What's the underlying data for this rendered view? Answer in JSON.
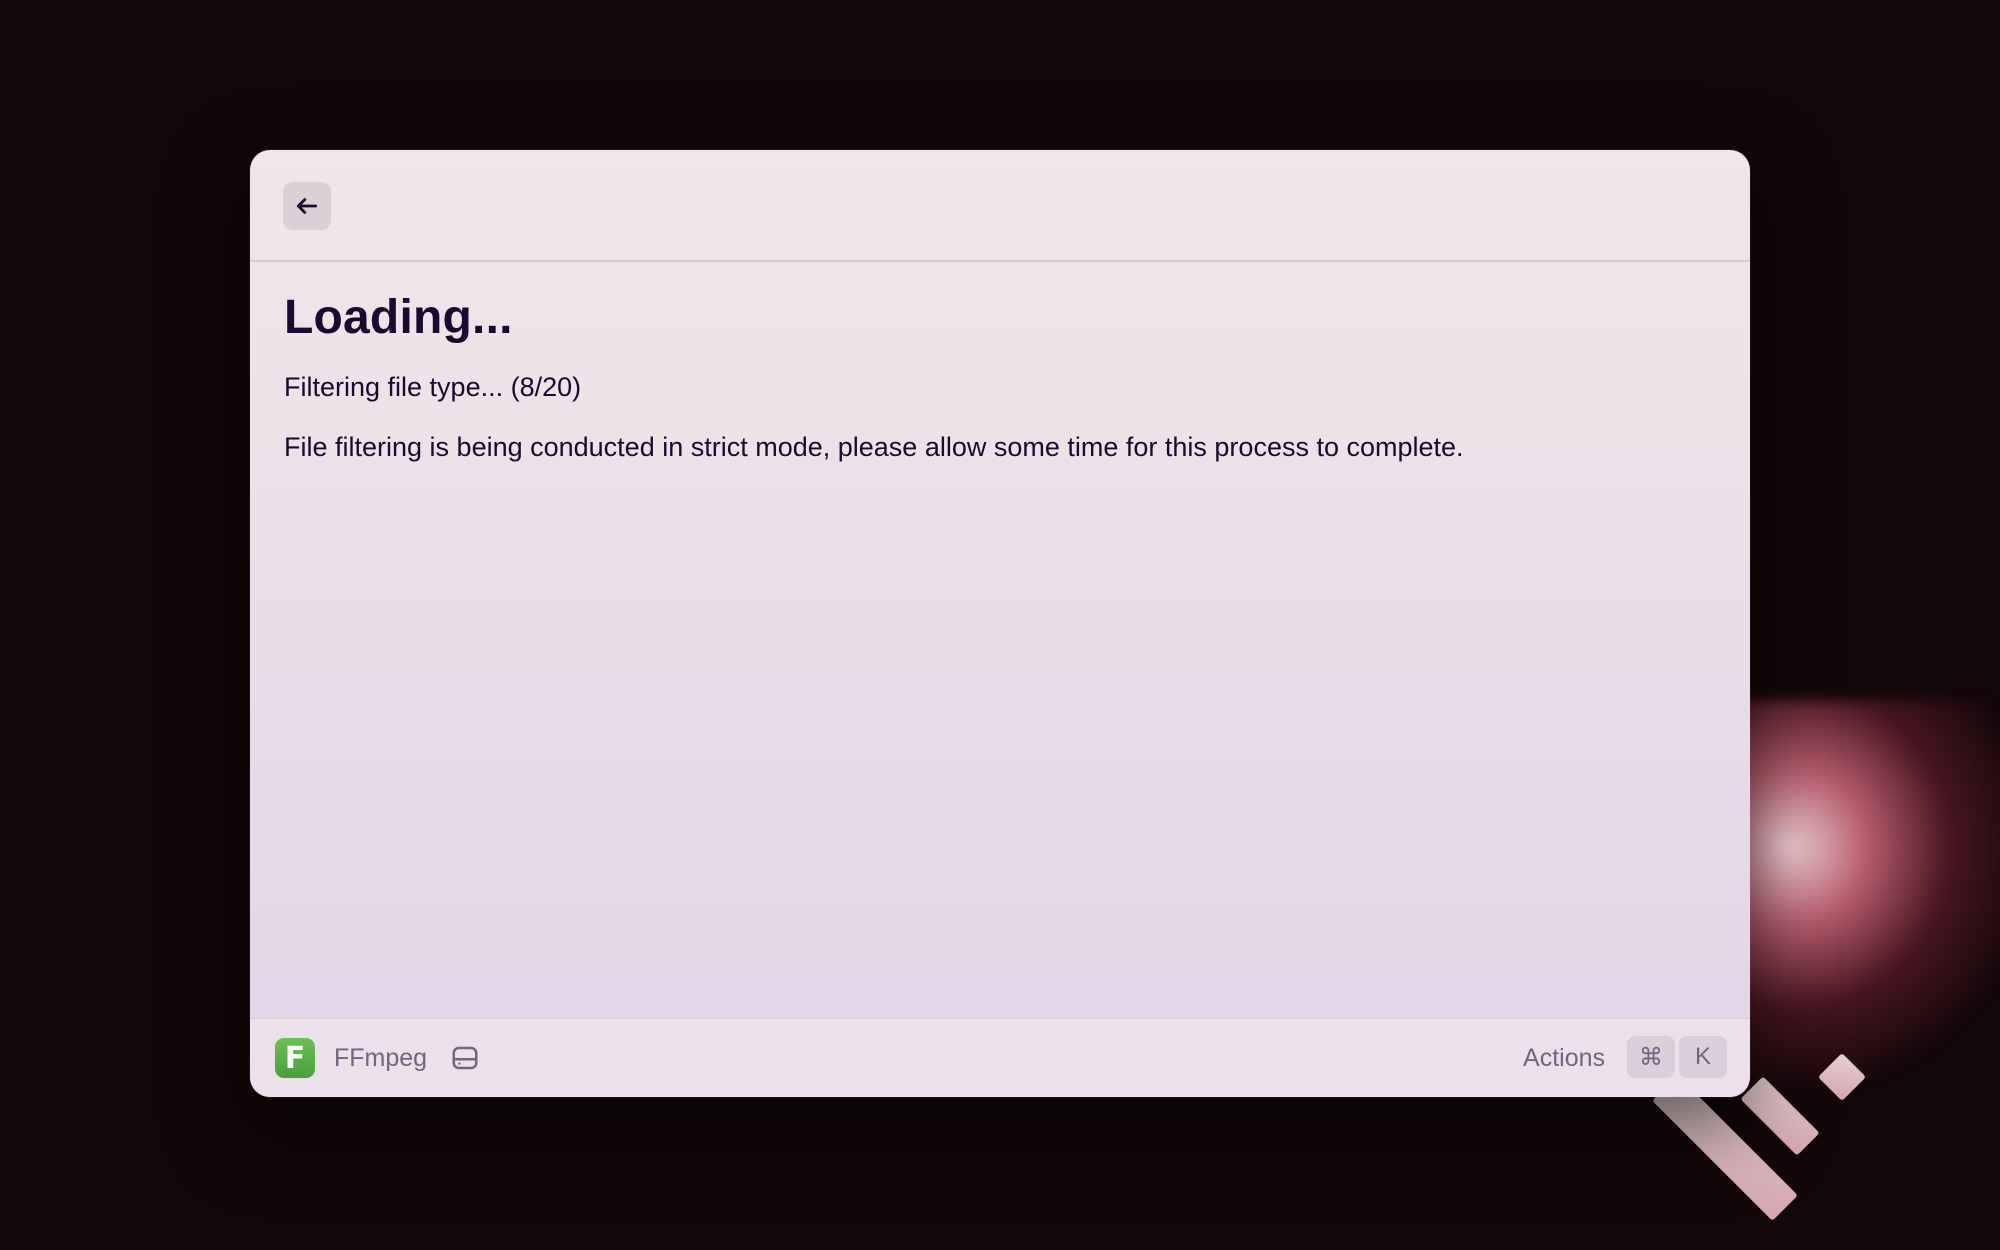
{
  "header": {
    "back_icon": "arrow-left-icon"
  },
  "main": {
    "title": "Loading...",
    "status": "Filtering file type... (8/20)",
    "description": "File filtering is being conducted in strict mode, please allow some time for this process to complete."
  },
  "footer": {
    "extension_icon_letter": "F",
    "extension_name": "FFmpeg",
    "extension_icon_color": "#5cb049",
    "storage_icon": "hard-drive-icon",
    "actions_label": "Actions",
    "shortcut_modifier": "⌘",
    "shortcut_key": "K"
  },
  "colors": {
    "text_primary": "#1b0a30",
    "text_secondary": "#6f6680",
    "background": "#120709"
  }
}
